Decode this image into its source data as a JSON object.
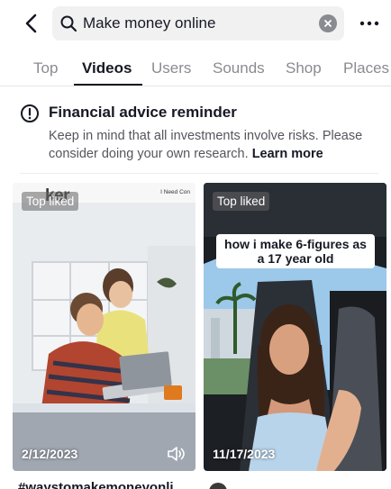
{
  "search": {
    "query": "Make money online"
  },
  "tabs": [
    {
      "label": "Top"
    },
    {
      "label": "Videos"
    },
    {
      "label": "Users"
    },
    {
      "label": "Sounds"
    },
    {
      "label": "Shop"
    },
    {
      "label": "Places"
    }
  ],
  "notice": {
    "title": "Financial advice reminder",
    "body": "Keep in mind that all investments involve risks. Please consider doing your own research. ",
    "link": "Learn more"
  },
  "videos": [
    {
      "badge": "Top liked",
      "date": "2/12/2023",
      "logo_text": "ker",
      "corner_text": "I Need Con"
    },
    {
      "badge": "Top liked",
      "date": "11/17/2023",
      "caption": "how i make 6-figures as a 17 year old"
    }
  ],
  "below_video_text": "#waystomakemoneyonli",
  "colors": {
    "text_primary": "#161823",
    "text_secondary": "#8a8b91",
    "search_bg": "#f1f1f2"
  }
}
